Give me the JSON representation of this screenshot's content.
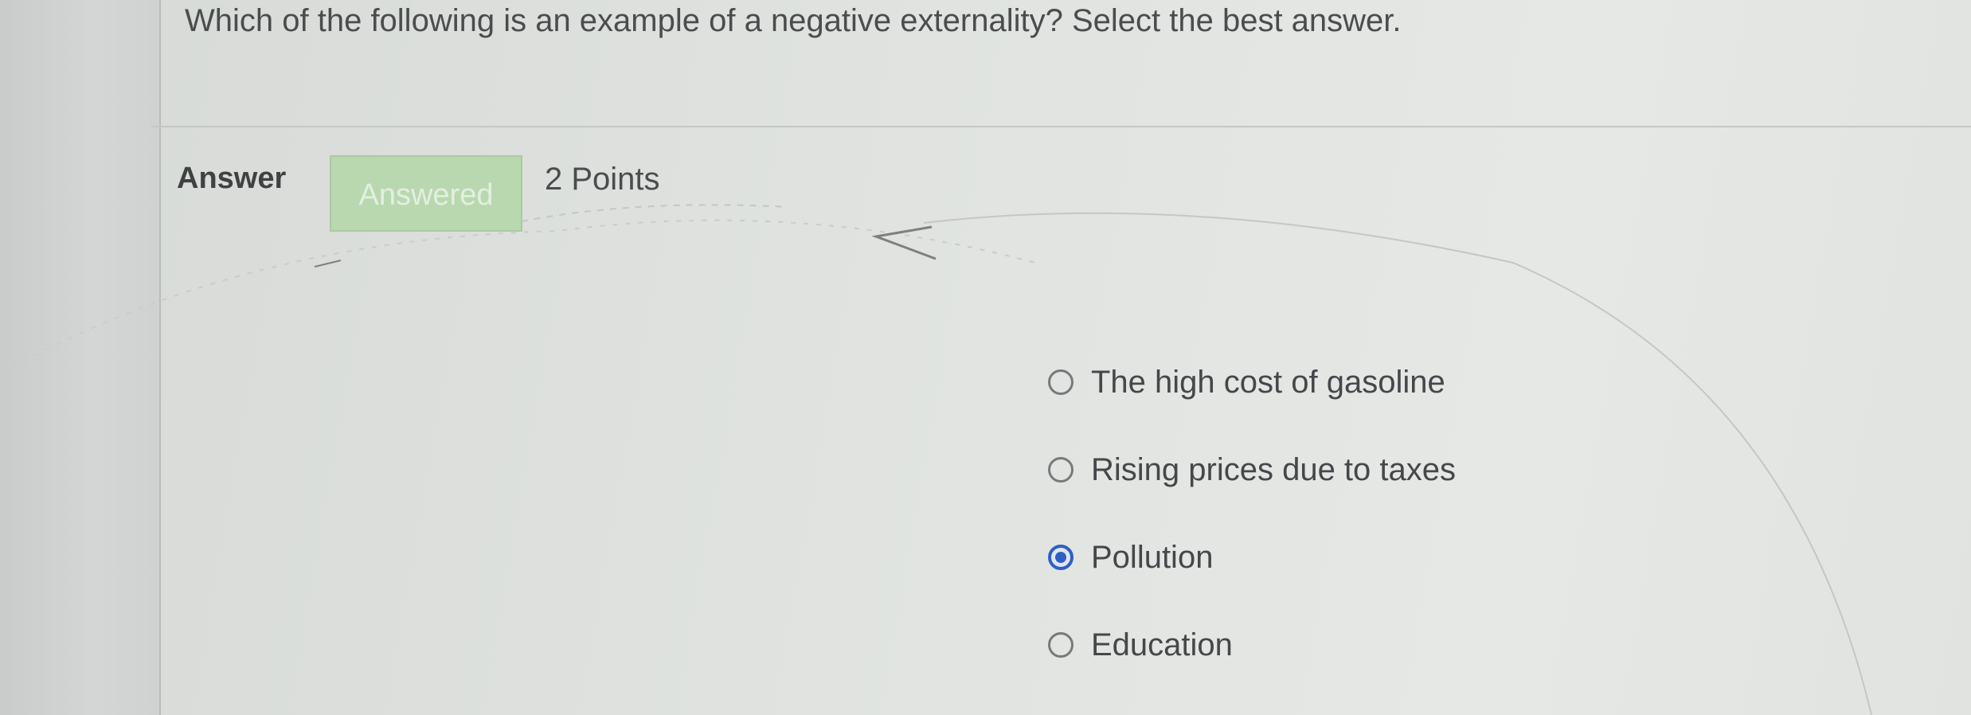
{
  "question": {
    "text": "Which of the following is an example of a negative externality? Select the best answer."
  },
  "answer_section": {
    "label": "Answer",
    "status": "Answered",
    "points": "2 Points"
  },
  "options": [
    {
      "label": "The high cost of gasoline",
      "selected": false
    },
    {
      "label": "Rising prices due to taxes",
      "selected": false
    },
    {
      "label": "Pollution",
      "selected": true
    },
    {
      "label": "Education",
      "selected": false
    }
  ],
  "colors": {
    "selected_radio": "#2f5fc4",
    "answered_badge": "#b9d8b0"
  }
}
